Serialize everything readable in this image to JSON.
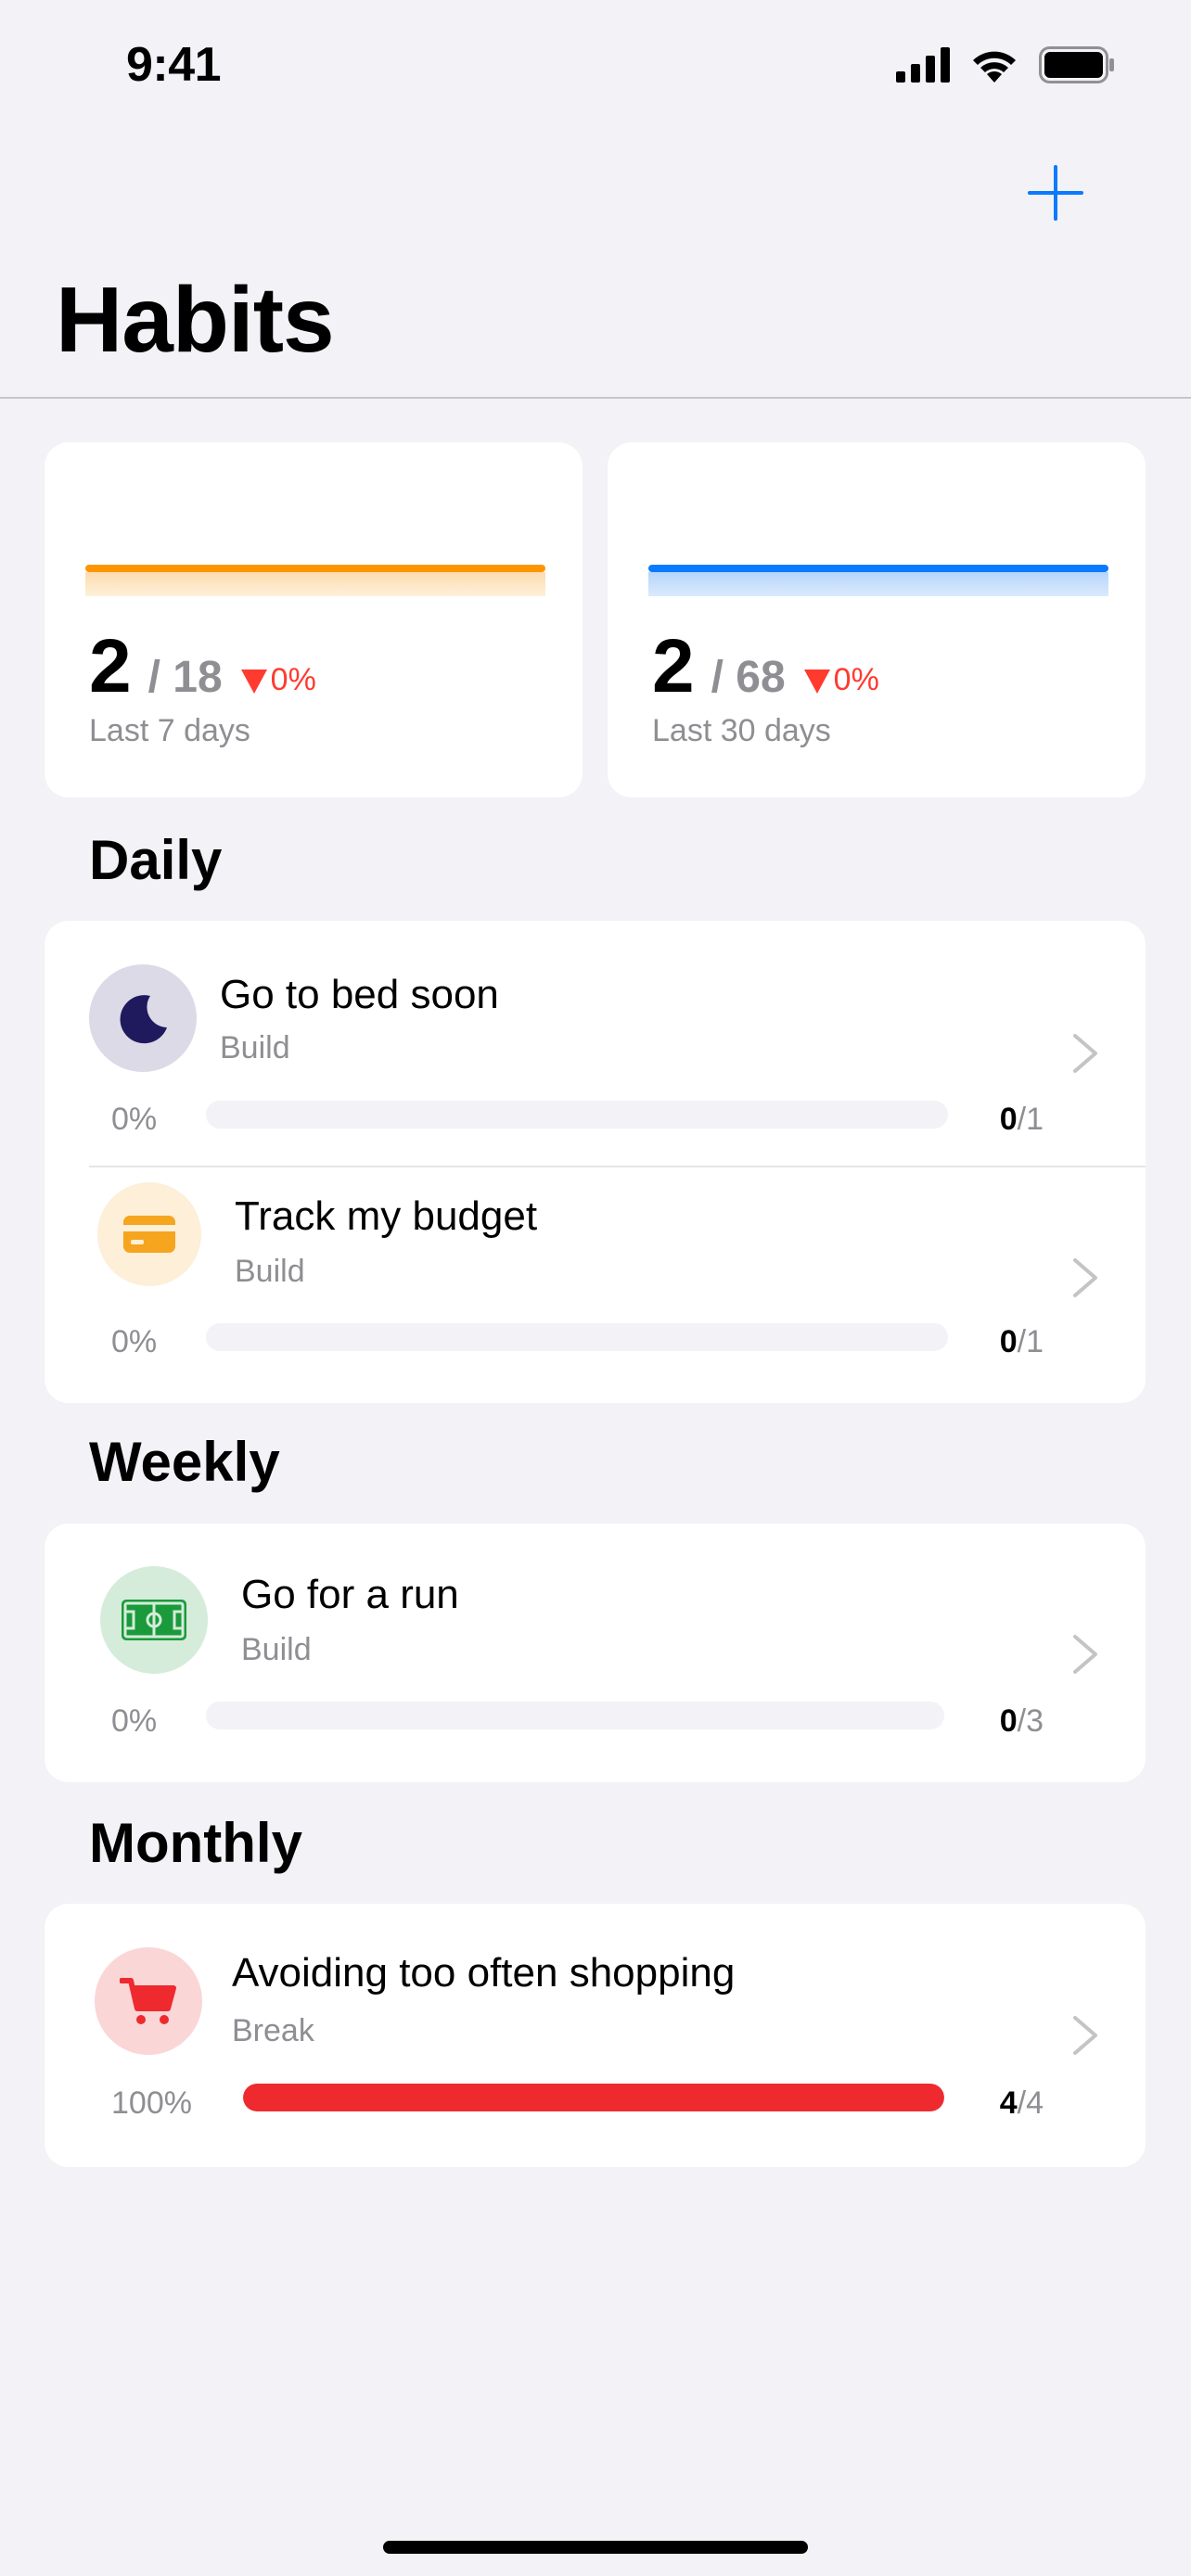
{
  "status_bar": {
    "time": "9:41"
  },
  "header": {
    "title": "Habits"
  },
  "stats": [
    {
      "value": "2",
      "total": "/ 18",
      "change": "0%",
      "label": "Last 7 days"
    },
    {
      "value": "2",
      "total": "/ 68",
      "change": "0%",
      "label": "Last 30 days"
    }
  ],
  "sections": {
    "daily": {
      "title": "Daily",
      "habits": [
        {
          "name": "Go to bed soon",
          "type": "Build",
          "percent": "0%",
          "progress": 0,
          "done": "0",
          "goal": "/1",
          "icon": "moon-icon"
        },
        {
          "name": "Track my budget",
          "type": "Build",
          "percent": "0%",
          "progress": 0,
          "done": "0",
          "goal": "/1",
          "icon": "credit-card-icon"
        }
      ]
    },
    "weekly": {
      "title": "Weekly",
      "habits": [
        {
          "name": "Go for a run",
          "type": "Build",
          "percent": "0%",
          "progress": 0,
          "done": "0",
          "goal": "/3",
          "icon": "sports-field-icon"
        }
      ]
    },
    "monthly": {
      "title": "Monthly",
      "habits": [
        {
          "name": "Avoiding too often shopping",
          "type": "Break",
          "percent": "100%",
          "progress": 1,
          "done": "4",
          "goal": "/4",
          "icon": "shopping-cart-icon"
        }
      ]
    }
  },
  "colors": {
    "accent": "#0a7aff",
    "week_bar": "#ff9500",
    "month_bar": "#0a7aff",
    "decrease": "#ff3b30",
    "break_progress": "#ee2a2f"
  }
}
